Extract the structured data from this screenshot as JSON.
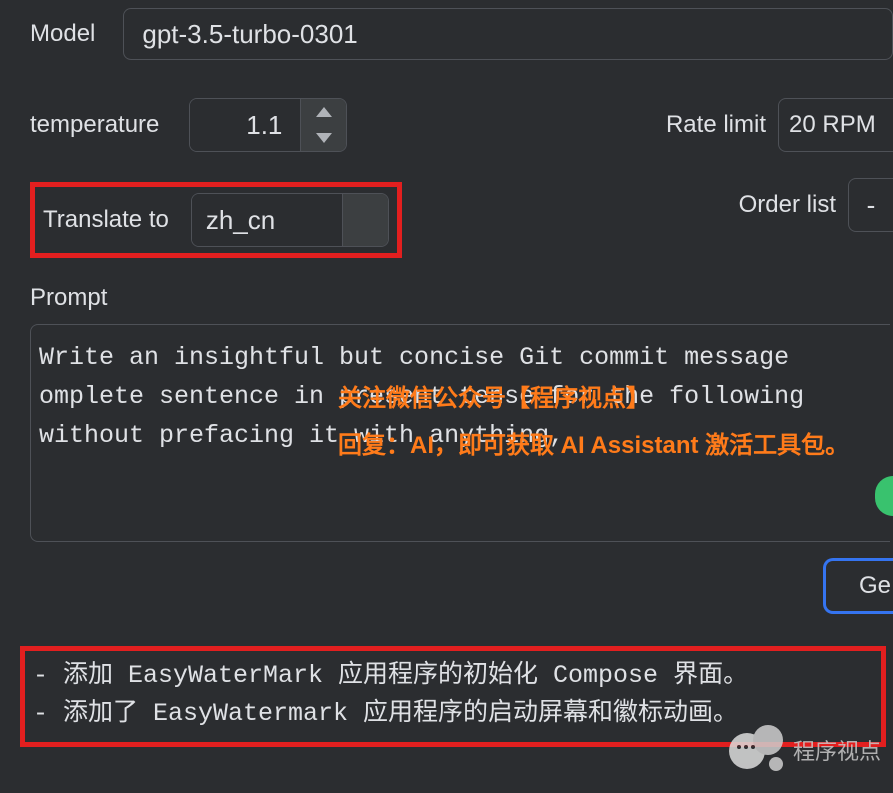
{
  "model": {
    "label": "Model",
    "value": "gpt-3.5-turbo-0301"
  },
  "temperature": {
    "label": "temperature",
    "value": "1.1"
  },
  "rate_limit": {
    "label": "Rate limit",
    "value": "20 RPM"
  },
  "translate": {
    "label": "Translate to",
    "value": "zh_cn"
  },
  "order_list": {
    "label": "Order list",
    "value": "-"
  },
  "prompt": {
    "label": "Prompt",
    "line1": "Write an insightful but concise Git commit message ",
    "line2": "omplete sentence in present tense for the following",
    "line3": "without prefacing it with anything,"
  },
  "overlay": {
    "line1": "关注微信公众号【程序视点】",
    "line2": "回复：AI，即可获取 AI Assistant 激活工具包。"
  },
  "generate_btn": "Ge",
  "output": {
    "line1": "- 添加 EasyWaterMark 应用程序的初始化 Compose 界面。",
    "line2": "- 添加了 EasyWatermark 应用程序的启动屏幕和徽标动画。"
  },
  "watermark_text": "程序视点"
}
